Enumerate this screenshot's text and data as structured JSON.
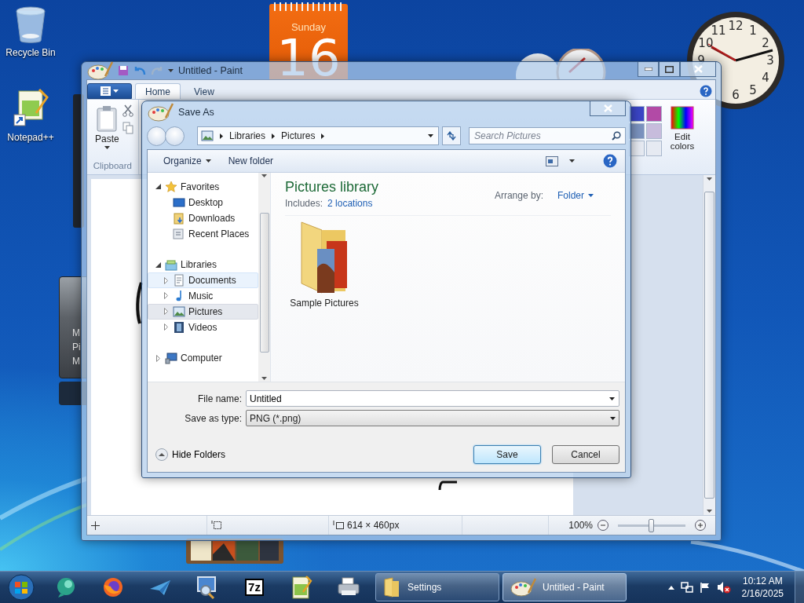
{
  "desktop_icons": [
    {
      "label": "Recycle Bin",
      "kind": "recycle"
    },
    {
      "label": "Notepad++",
      "kind": "notepad"
    }
  ],
  "calendar_gadget": {
    "weekday": "Sunday",
    "day": "16"
  },
  "clock_gadget": {
    "numbers": [
      "9",
      "10",
      "11",
      "12",
      "1",
      "2",
      "3",
      "4",
      "5",
      "6"
    ]
  },
  "slideshow_gadget": {
    "lines": [
      "M",
      "Pi",
      "M"
    ]
  },
  "paint": {
    "title": "Untitled - Paint",
    "tabs": [
      {
        "label": "Home",
        "selected": true
      },
      {
        "label": "View",
        "selected": false
      }
    ],
    "ribbon": {
      "paste": "Paste",
      "clipboard_group": "Clipboard",
      "edit_colors": "Edit colors",
      "colors": [
        {
          "color": "#3b46c6"
        },
        {
          "color": "#b24aa6"
        },
        {
          "color": "#7b93bf"
        },
        {
          "color": "#c7bcdc"
        },
        {
          "color": "#e6eaf2"
        },
        {
          "color": "#e6eaf2"
        }
      ]
    },
    "status_bar": {
      "canvas_size": "614 × 460px",
      "zoom": "100%",
      "zoom_slider": {
        "level": 0.5
      }
    }
  },
  "save_dialog": {
    "title": "Save As",
    "breadcrumb": [
      "Libraries",
      "Pictures"
    ],
    "search_placeholder": "Search Pictures",
    "toolbar": {
      "organize": "Organize",
      "new_folder": "New folder"
    },
    "nav": [
      {
        "label": "Favorites",
        "kind": "favorites",
        "expanded": true,
        "selected": false,
        "hovered": false,
        "children": [
          {
            "label": "Desktop",
            "kind": "desktop",
            "selected": false,
            "hovered": false
          },
          {
            "label": "Downloads",
            "kind": "downloads",
            "selected": false,
            "hovered": false
          },
          {
            "label": "Recent Places",
            "kind": "recent",
            "selected": false,
            "hovered": false
          }
        ]
      },
      {
        "label": "Libraries",
        "kind": "libraries",
        "expanded": true,
        "selected": false,
        "hovered": false,
        "children": [
          {
            "label": "Documents",
            "kind": "documents",
            "expanded": false,
            "selected": false,
            "hovered": true
          },
          {
            "label": "Music",
            "kind": "music",
            "expanded": false,
            "selected": false,
            "hovered": false
          },
          {
            "label": "Pictures",
            "kind": "pictures",
            "expanded": false,
            "selected": true,
            "hovered": false
          },
          {
            "label": "Videos",
            "kind": "videos",
            "expanded": false,
            "selected": false,
            "hovered": false
          }
        ]
      },
      {
        "label": "Computer",
        "kind": "computer",
        "expanded": false,
        "selected": false,
        "hovered": false
      }
    ],
    "library": {
      "title": "Pictures library",
      "includes_label": "Includes:",
      "includes_link": "2 locations",
      "arrange_label": "Arrange by:",
      "arrange_value": "Folder"
    },
    "items": [
      {
        "label": "Sample Pictures",
        "kind": "picture-folder"
      }
    ],
    "file_name": {
      "label": "File name:",
      "value": "Untitled"
    },
    "save_type": {
      "label": "Save as type:",
      "value": "PNG (*.png)"
    },
    "hide_folders": "Hide Folders",
    "buttons": [
      {
        "label": "Save",
        "default": true
      },
      {
        "label": "Cancel",
        "default": false
      }
    ]
  },
  "taskbar": {
    "pinned": [
      {
        "kind": "messenger"
      },
      {
        "kind": "firefox"
      },
      {
        "kind": "plane"
      },
      {
        "kind": "computer"
      },
      {
        "kind": "sevenzip",
        "label": "7z"
      },
      {
        "kind": "notepad"
      },
      {
        "kind": "printer"
      }
    ],
    "tasks": [
      {
        "label": "Settings",
        "kind": "folder",
        "selected": false
      },
      {
        "label": "Untitled - Paint",
        "kind": "paint",
        "selected": true
      }
    ],
    "tray": {
      "muted": true,
      "time": "10:12 AM",
      "date": "2/16/2025"
    }
  }
}
